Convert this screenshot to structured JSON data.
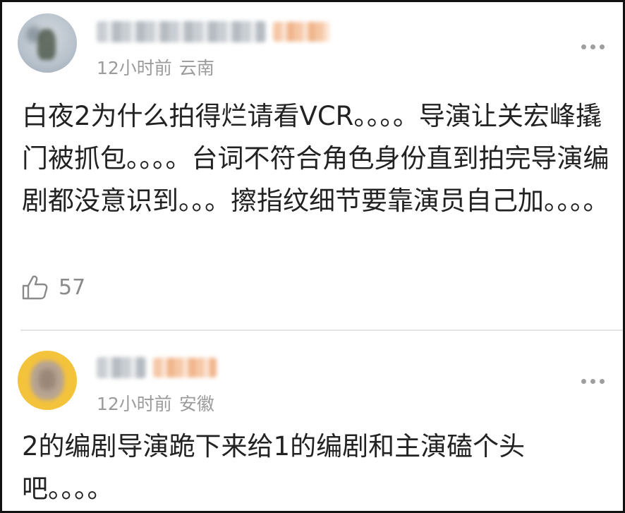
{
  "comments": [
    {
      "time": "12小时前",
      "location": "云南",
      "text": "白夜2为什么拍得烂请看VCR。。。。导演让关宏峰撬门被抓包。。。。台词不符合角色身份直到拍完导演编剧都没意识到。。。擦指纹细节要靠演员自己加。。。。",
      "likes": "57"
    },
    {
      "time": "12小时前",
      "location": "安徽",
      "text": "2的编剧导演跪下来给1的编剧和主演磕个头吧。。。。"
    }
  ],
  "colors": {
    "meta": "#9b9b9b",
    "text": "#222222",
    "avatar2_bg": "#f4c33c"
  },
  "icons": {
    "like": "thumbs-up-icon",
    "more": "more-dots-icon"
  }
}
